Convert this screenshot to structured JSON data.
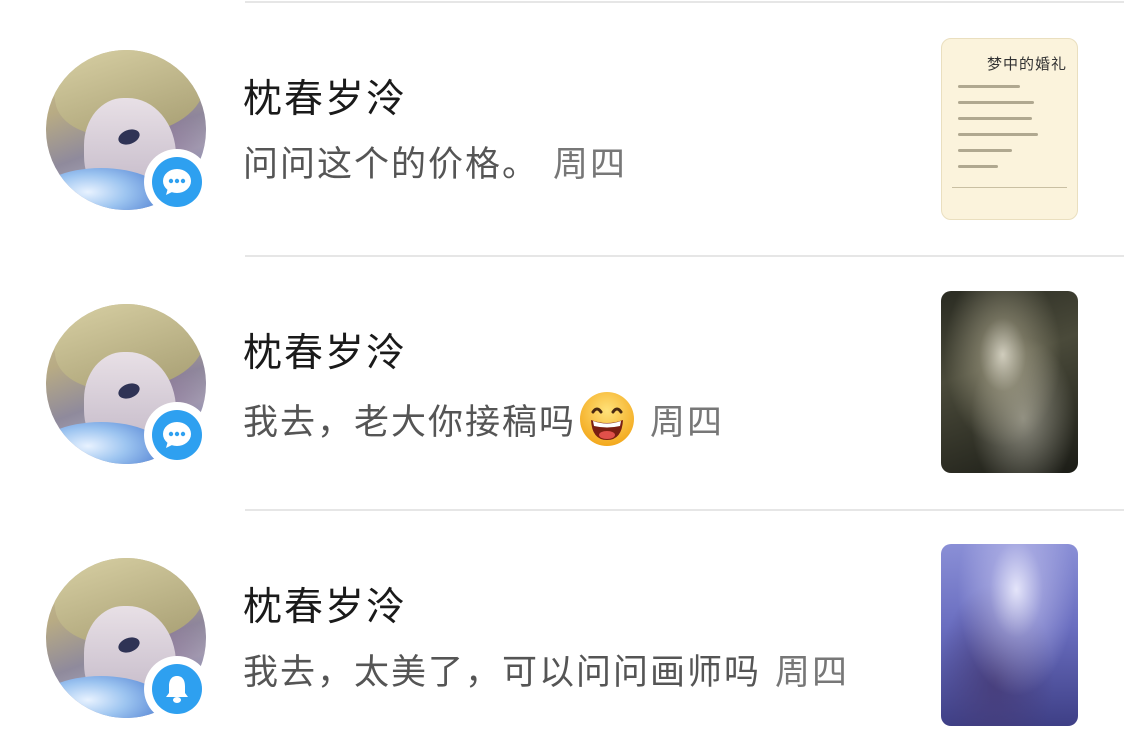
{
  "conversations": [
    {
      "name": "枕春岁泠",
      "message": "问问这个的价格。",
      "time": "周四",
      "has_emoji": false,
      "badge_icon": "chat-bubble-icon",
      "thumbnail": "document-image",
      "thumbnail_title": "梦中的婚礼"
    },
    {
      "name": "枕春岁泠",
      "message": "我去，老大你接稿吗",
      "time": "周四",
      "has_emoji": true,
      "emoji": "grinning-face-emoji",
      "badge_icon": "chat-bubble-icon",
      "thumbnail": "dark-artwork-image"
    },
    {
      "name": "枕春岁泠",
      "message": "我去，太美了，可以问问画师吗",
      "time": "周四",
      "has_emoji": false,
      "badge_icon": "bell-icon",
      "thumbnail": "blue-artwork-image"
    }
  ],
  "colors": {
    "badge": "#2ea0f0",
    "name_text": "#1a1a1a",
    "message_text": "#555555",
    "divider": "#e6e6e6"
  }
}
